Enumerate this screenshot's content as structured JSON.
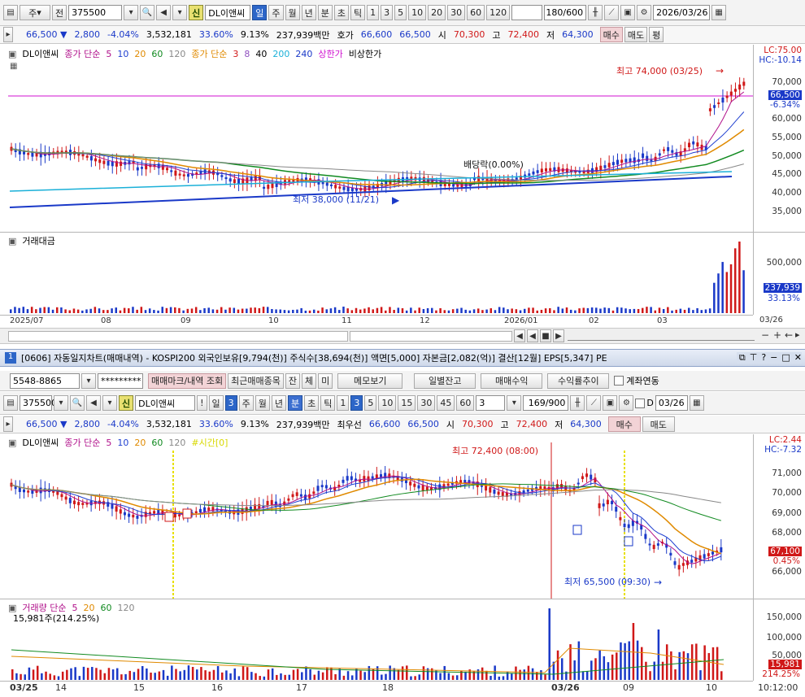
{
  "top": {
    "toolbar": {
      "mode": "주",
      "prev": "전",
      "code": "375500",
      "sin": "신",
      "name": "DL이앤씨",
      "periods": [
        "일",
        "주",
        "월",
        "년",
        "분",
        "초",
        "틱"
      ],
      "nums": [
        "1",
        "3",
        "5",
        "10",
        "20",
        "30",
        "60",
        "120"
      ],
      "count": "180/600",
      "date": "2026/03/26"
    },
    "quote": {
      "price": "66,500",
      "change": "2,800",
      "pct": "-4.04%",
      "volume": "3,532,181",
      "turnover": "33.60%",
      "ratio": "9.13%",
      "amount": "237,939백만",
      "hoga_label": "호가",
      "ask": "66,600",
      "bid": "66,500",
      "open_label": "시",
      "open": "70,300",
      "high_label": "고",
      "high": "72,400",
      "low_label": "저",
      "low": "64,300",
      "buy": "매수",
      "sell": "매도",
      "pyeong": "평"
    },
    "legend": {
      "name": "DL이앤씨",
      "ma_label": "종가 단순",
      "ma": [
        "5",
        "10",
        "20",
        "60",
        "120"
      ],
      "ma2_label": "종가 단순",
      "ma2": [
        "3",
        "8",
        "40",
        "200",
        "240"
      ],
      "upper": "상한가",
      "lower": "비상한가"
    },
    "annotations": {
      "high": "최고 74,000 (03/25)",
      "low": "최저 38,000 (11/21)",
      "dividend": "배당락(0.00%)"
    },
    "yaxis": [
      "70,000",
      "65,000",
      "60,000",
      "55,000",
      "50,000",
      "45,000",
      "40,000",
      "35,000"
    ],
    "lc": "LC:75.00",
    "hc": "HC:-10.14",
    "price_tag": "66,500",
    "pct_tag": "-6.34%",
    "volume_title": "거래대금",
    "vol_yaxis": [
      "500,000"
    ],
    "vol_tag": "237,939",
    "vol_pct": "33.13%",
    "xaxis": [
      "2025/07",
      "08",
      "09",
      "10",
      "11",
      "12",
      "2026/01",
      "02",
      "03",
      "03/26"
    ]
  },
  "bottom": {
    "title": "[0606] 자동일지차트(매매내역) - KOSPI200 외국인보유[9,794(천)] 주식수[38,694(천)] 액면[5,000] 자본금[2,082(억)] 결산[12월] EPS[5,347] PE",
    "account": "5548-8865",
    "password": "*********",
    "tabs": [
      "매매마크/내역 조회",
      "최근매매종목",
      "잔",
      "체",
      "미",
      "메모보기",
      "일별잔고",
      "매매수익",
      "수익률추이"
    ],
    "link_label": "계좌연동",
    "toolbar": {
      "code": "375500",
      "sin": "신",
      "name": "DL이앤씨",
      "warn": "!",
      "periods": [
        "일",
        "3",
        "주",
        "월",
        "년",
        "분",
        "초",
        "틱"
      ],
      "nums": [
        "1",
        "3",
        "5",
        "10",
        "15",
        "30",
        "45",
        "60"
      ],
      "sel_num": "3",
      "count": "169/900",
      "date_label": "D",
      "date": "03/26"
    },
    "quote": {
      "price": "66,500",
      "change": "2,800",
      "pct": "-4.04%",
      "volume": "3,532,181",
      "turnover": "33.60%",
      "ratio": "9.13%",
      "amount": "237,939백만",
      "hoga_label": "최우선",
      "ask": "66,600",
      "bid": "66,500",
      "open_label": "시",
      "open": "70,300",
      "high_label": "고",
      "high": "72,400",
      "low_label": "저",
      "low": "64,300",
      "buy": "매수",
      "sell": "매도"
    },
    "legend": {
      "name": "DL이앤씨",
      "ma_label": "종가 단순",
      "ma": [
        "5",
        "10",
        "20",
        "60",
        "120"
      ],
      "time": "#시간[0]"
    },
    "annotations": {
      "high": "최고 72,400 (08:00)",
      "low": "최저 65,500 (09:30)"
    },
    "yaxis": [
      "71,000",
      "70,000",
      "69,000",
      "68,000",
      "66,000"
    ],
    "lc": "LC:2.44",
    "hc": "HC:-7.32",
    "price_tag": "67,100",
    "pct_tag": "0.45%",
    "volume_legend": "거래량 단순",
    "vol_ma": [
      "5",
      "20",
      "60",
      "120"
    ],
    "vol_info": "15,981주(214.25%)",
    "vol_yaxis": [
      "150,000",
      "100,000",
      "50,000"
    ],
    "vol_tag": "15,981",
    "vol_pct": "214.25%",
    "xaxis": [
      "03/25",
      "14",
      "15",
      "16",
      "17",
      "18",
      "03/26",
      "09",
      "10",
      "10:12:00"
    ]
  }
}
